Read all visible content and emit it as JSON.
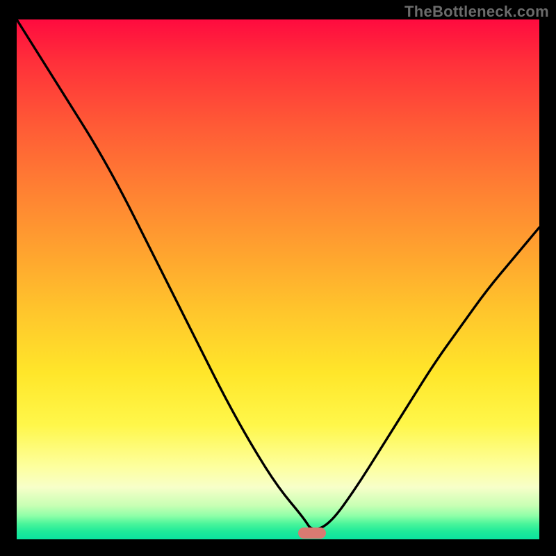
{
  "watermark": "TheBottleneck.com",
  "colors": {
    "curve_stroke": "#000000",
    "marker_fill": "#d97a72"
  },
  "chart_data": {
    "type": "line",
    "title": "",
    "xlabel": "",
    "ylabel": "",
    "xlim": [
      0,
      100
    ],
    "ylim": [
      0,
      100
    ],
    "grid": false,
    "legend": false,
    "series": [
      {
        "name": "bottleneck-curve",
        "x": [
          0,
          5,
          10,
          15,
          20,
          25,
          30,
          35,
          40,
          45,
          50,
          55,
          56.5,
          60,
          65,
          70,
          75,
          80,
          85,
          90,
          95,
          100
        ],
        "y": [
          100,
          92,
          84,
          76,
          67,
          57,
          47,
          37,
          27,
          18,
          10,
          4,
          1.5,
          3,
          10,
          18,
          26,
          34,
          41,
          48,
          54,
          60
        ]
      }
    ],
    "marker": {
      "x": 56.5,
      "y": 1.2
    }
  }
}
